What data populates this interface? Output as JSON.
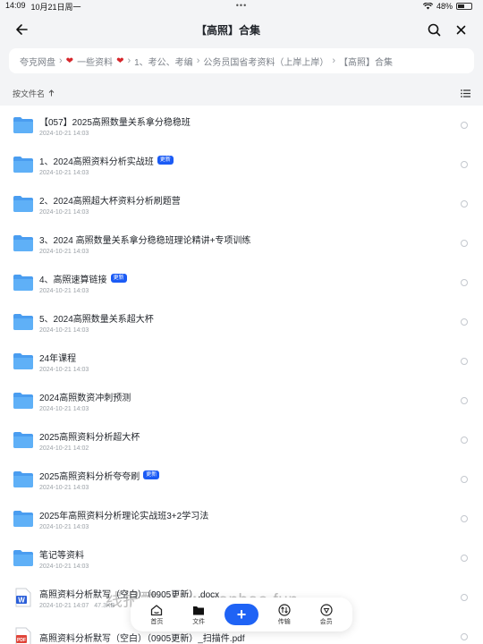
{
  "status_bar": {
    "time": "14:09",
    "date": "10月21日周一",
    "dots": "•••",
    "battery": "48%"
  },
  "header": {
    "title": "【高照】合集"
  },
  "breadcrumb": {
    "items": [
      "夸克网盘",
      "一些资料",
      "1、考公、考编",
      "公务员国省考资料（上岸上岸）",
      "【高照】合集"
    ]
  },
  "sort_bar": {
    "label": "按文件名"
  },
  "files": [
    {
      "name": "【057】2025高照数量关系拿分稳稳班",
      "date": "2024-10-21 14:03",
      "badge": "",
      "type": "folder"
    },
    {
      "name": "1、2024高照资料分析实战班",
      "date": "2024-10-21 14:03",
      "badge": "更新",
      "type": "folder"
    },
    {
      "name": "2、2024高照超大杯资料分析刷题营",
      "date": "2024-10-21 14:03",
      "badge": "",
      "type": "folder"
    },
    {
      "name": "3、2024 高照数量关系拿分稳稳班理论精讲+专项训练",
      "date": "2024-10-21 14:03",
      "badge": "",
      "type": "folder"
    },
    {
      "name": "4、高照速算链接",
      "date": "2024-10-21 14:03",
      "badge": "更新",
      "type": "folder"
    },
    {
      "name": "5、2024高照数量关系超大杯",
      "date": "2024-10-21 14:03",
      "badge": "",
      "type": "folder"
    },
    {
      "name": "24年课程",
      "date": "2024-10-21 14:03",
      "badge": "",
      "type": "folder"
    },
    {
      "name": "2024高照数资冲刺预测",
      "date": "2024-10-21 14:03",
      "badge": "",
      "type": "folder"
    },
    {
      "name": "2025高照资料分析超大杯",
      "date": "2024-10-21 14:02",
      "badge": "",
      "type": "folder"
    },
    {
      "name": "2025高照资料分析夸夸刷",
      "date": "2024-10-21 14:03",
      "badge": "更新",
      "type": "folder"
    },
    {
      "name": "2025年高照资料分析理论实战班3+2学习法",
      "date": "2024-10-21 14:03",
      "badge": "",
      "type": "folder"
    },
    {
      "name": "笔记等资料",
      "date": "2024-10-21 14:03",
      "badge": "",
      "type": "folder"
    },
    {
      "name": "高照资料分析默写（空白）（0905更新）.docx",
      "date": "2024-10-21 14:07",
      "size": "47.3KB",
      "badge": "",
      "type": "docx"
    },
    {
      "name": "高照资料分析默写（空白）（0905更新）_扫描件.pdf",
      "date": "",
      "badge": "",
      "type": "pdf"
    }
  ],
  "watermark": "线报酷 www.xianbao.fun",
  "tabbar": {
    "home": "首页",
    "files": "文件",
    "transfer": "传输",
    "member": "会员"
  },
  "colors": {
    "accent": "#1f63f5",
    "folder": "#4a9df0",
    "badge": "#1b5bf5"
  }
}
